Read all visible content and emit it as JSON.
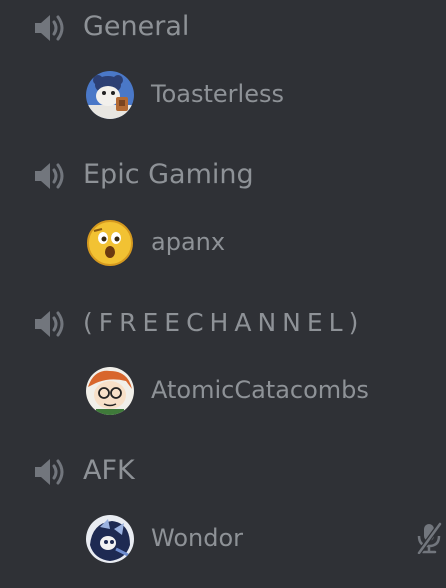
{
  "channels": [
    {
      "name": "General",
      "user": {
        "name": "Toasterless"
      }
    },
    {
      "name": "Epic Gaming",
      "user": {
        "name": "apanx"
      }
    },
    {
      "name": "(FREECHANNEL)",
      "user": {
        "name": "AtomicCatacombs"
      }
    },
    {
      "name": "AFK",
      "user": {
        "name": "Wondor",
        "muted": true
      }
    }
  ],
  "colors": {
    "background": "#2f3136",
    "text": "#8e9297",
    "icon": "#72767d"
  }
}
